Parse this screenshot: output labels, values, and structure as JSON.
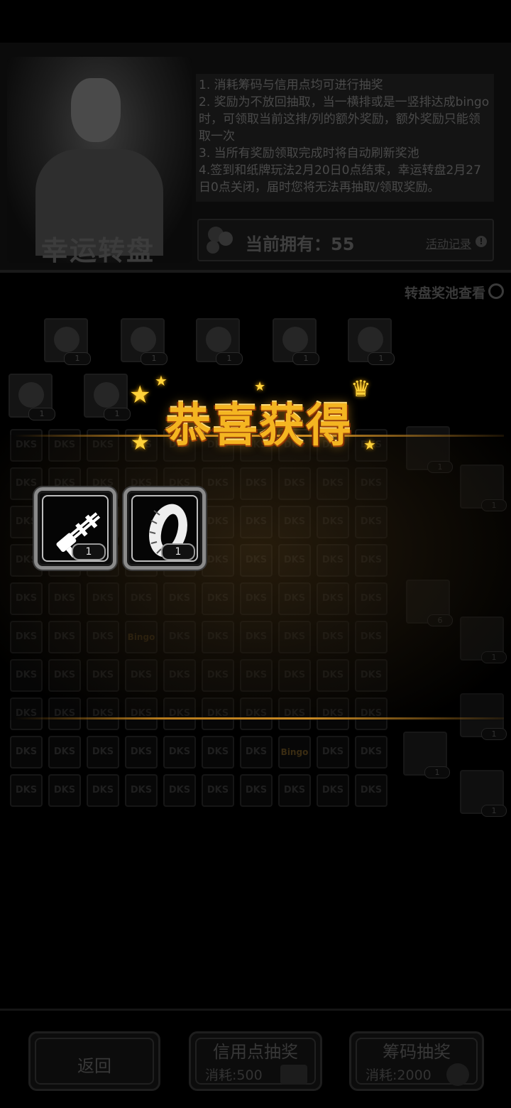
{
  "header": {
    "title": "幸运转盘",
    "rules": [
      "1. 消耗筹码与信用点均可进行抽奖",
      "2. 奖励为不放回抽取，当一横排或是一竖排达成bingo时，可领取当前这排/列的额外奖励，额外奖励只能领取一次",
      "3. 当所有奖励领取完成时将自动刷新奖池",
      "4.签到和纸牌玩法2月20日0点结束，幸运转盘2月27日0点关闭，届时您将无法再抽取/领取奖励。"
    ],
    "owned_label": "当前拥有：55",
    "record_link": "活动记录",
    "info_icon": "!"
  },
  "pool_link": "转盘奖池查看",
  "reward_row1_badges": [
    "1",
    "1",
    "1",
    "1",
    "1"
  ],
  "reward_row2_badges": [
    "1",
    "1"
  ],
  "grid": {
    "cell_text": "DKS",
    "bingo_text": "Bingo",
    "bingo_cells": [
      [
        5,
        3
      ],
      [
        8,
        7
      ]
    ]
  },
  "side_badges": [
    "1",
    "1",
    "6",
    "1",
    "1",
    "1",
    "1"
  ],
  "popup": {
    "title": "恭喜获得",
    "prizes": [
      {
        "name": "minigun",
        "qty": "1"
      },
      {
        "name": "tire",
        "qty": "1"
      }
    ]
  },
  "bottom": {
    "back_label": "返回",
    "credit_label": "信用点抽奖",
    "credit_cost": "消耗:500",
    "chip_label": "筹码抽奖",
    "chip_cost": "消耗:2000"
  },
  "colors": {
    "accent": "#f4b521",
    "gold_line": "#c98a24"
  }
}
